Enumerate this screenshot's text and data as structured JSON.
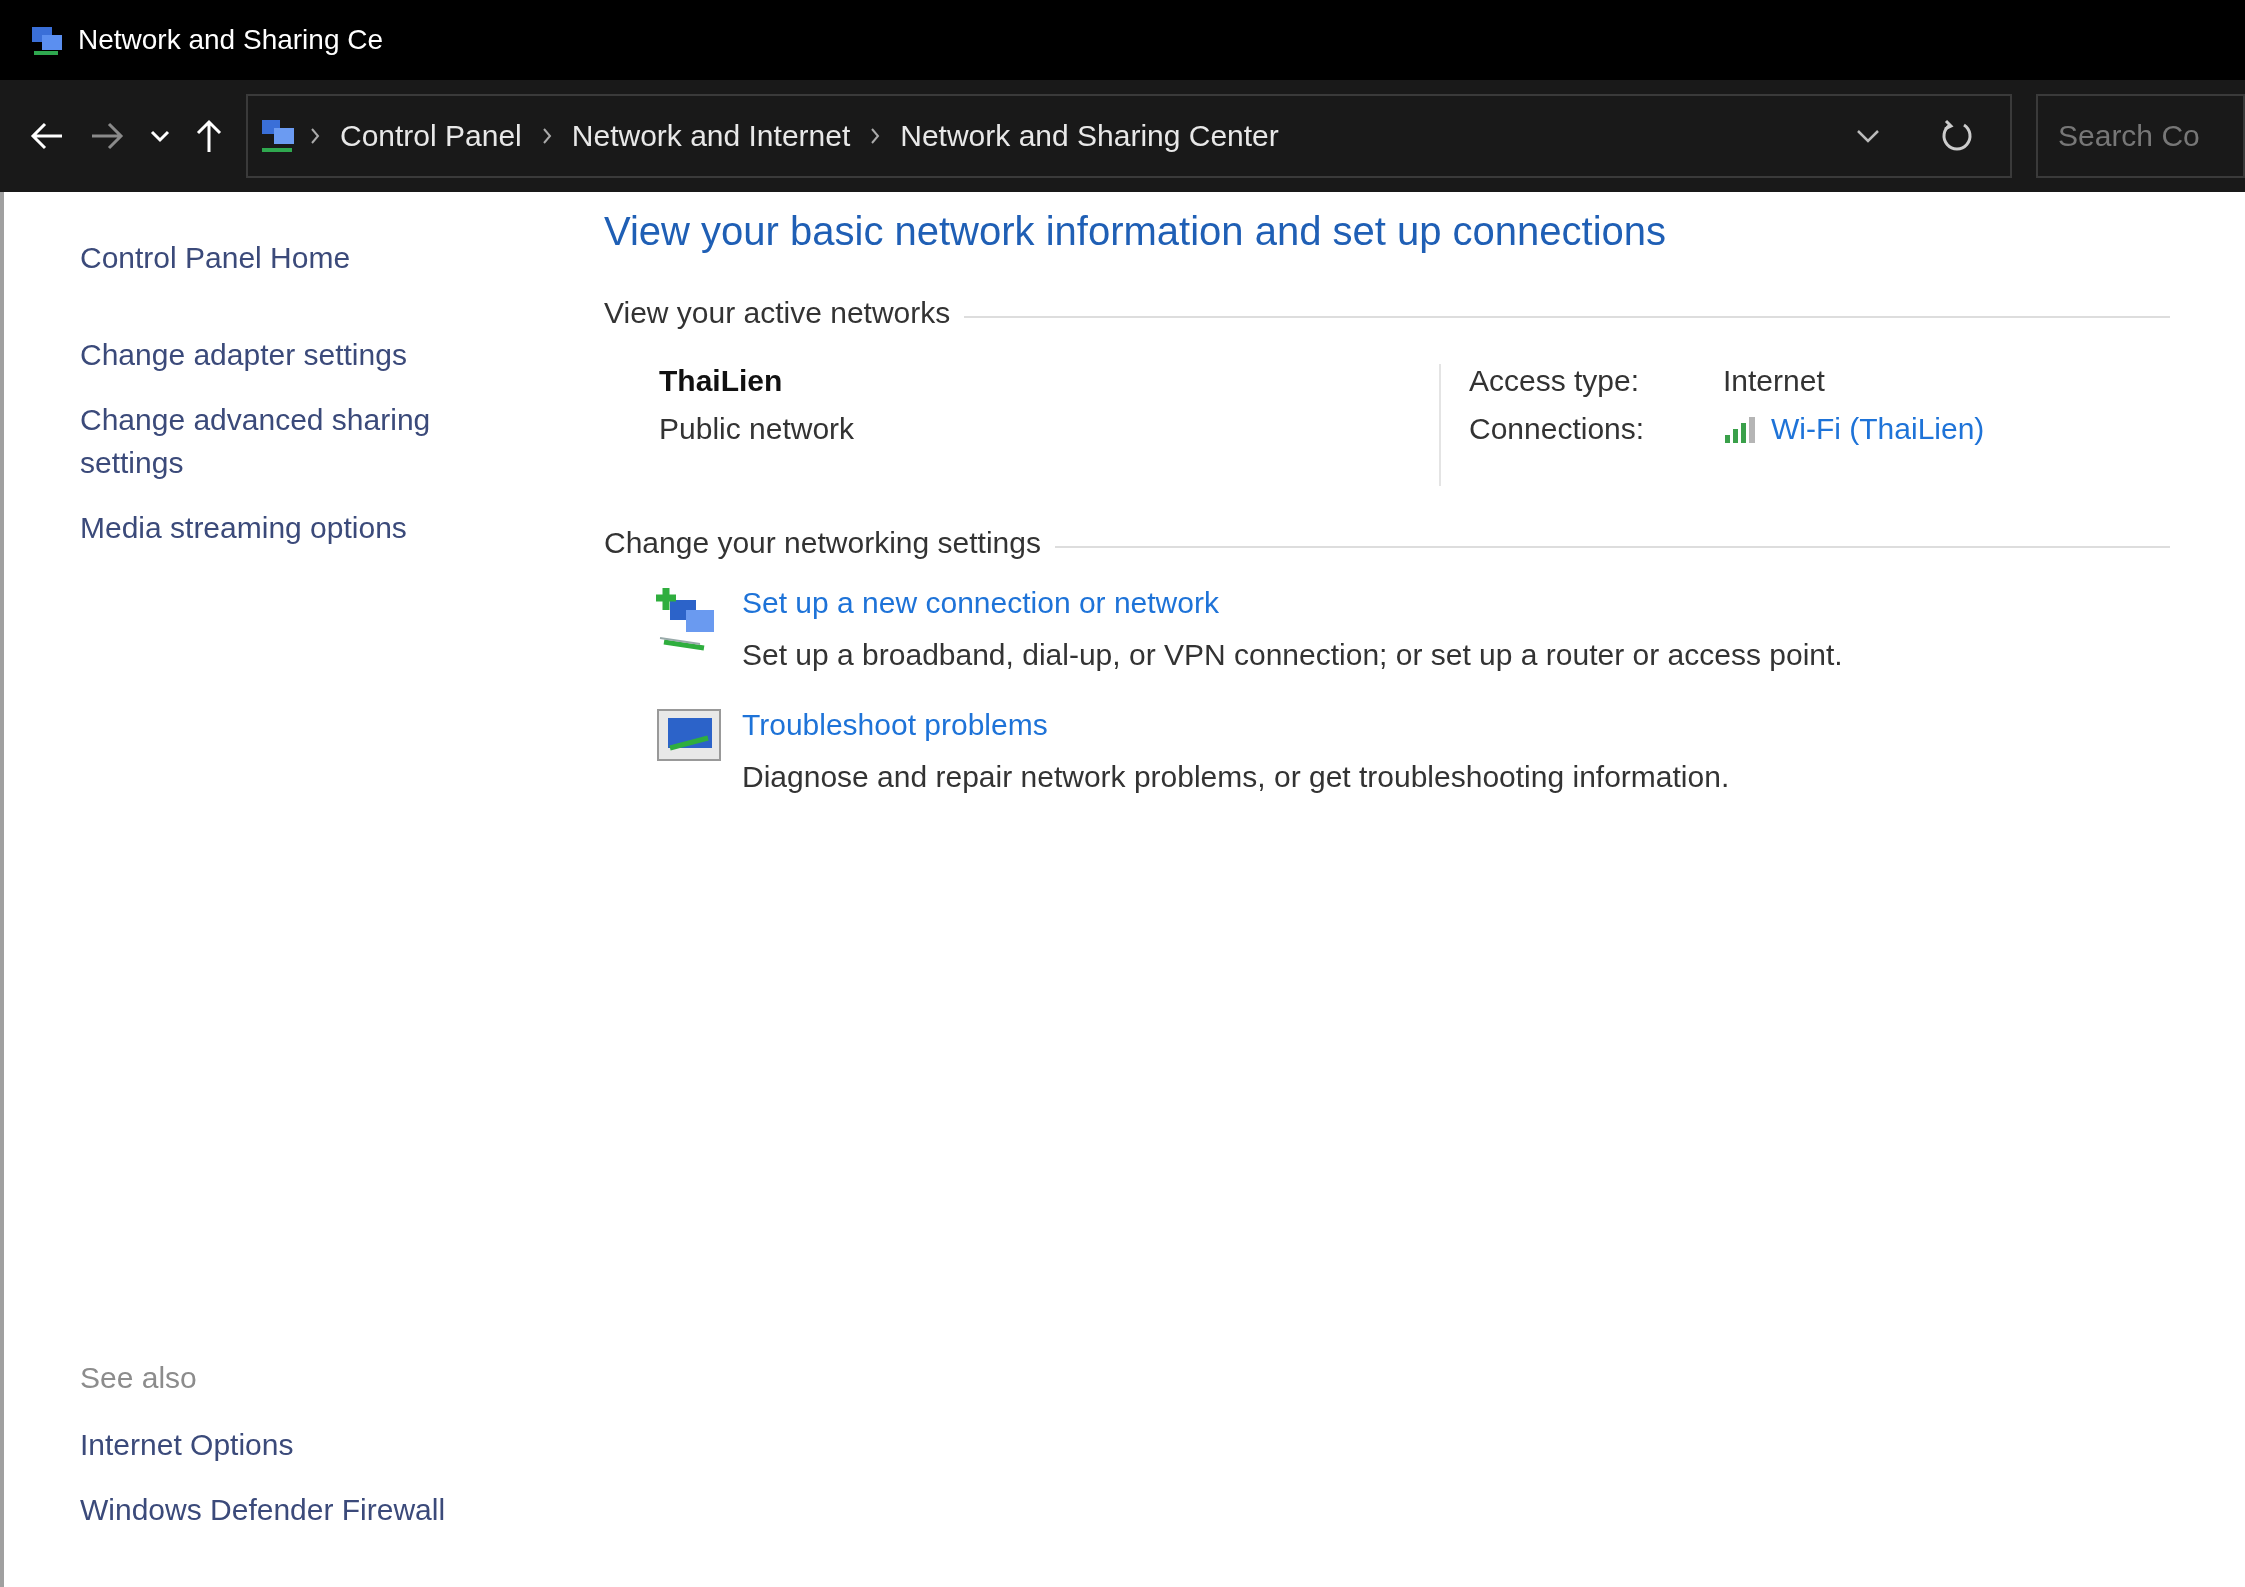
{
  "window": {
    "title": "Network and Sharing Ce"
  },
  "address_bar": {
    "breadcrumbs": [
      "Control Panel",
      "Network and Internet",
      "Network and Sharing Center"
    ]
  },
  "search": {
    "placeholder": "Search Co"
  },
  "sidebar": {
    "items": [
      "Control Panel Home",
      "Change adapter settings",
      "Change advanced sharing settings",
      "Media streaming options"
    ],
    "see_also": {
      "title": "See also",
      "items": [
        "Internet Options",
        "Windows Defender Firewall"
      ]
    }
  },
  "main": {
    "heading": "View your basic network information and set up connections",
    "active_networks": {
      "title": "View your active networks",
      "network": {
        "name": "ThaiLien",
        "category": "Public network"
      },
      "access_type": {
        "label": "Access type:",
        "value": "Internet"
      },
      "connections": {
        "label": "Connections:",
        "value": "Wi-Fi (ThaiLien)"
      }
    },
    "settings": {
      "title": "Change your networking settings",
      "tasks": [
        {
          "kind": "setup",
          "link": "Set up a new connection or network",
          "description": "Set up a broadband, dial-up, or VPN connection; or set up a router or access point."
        },
        {
          "kind": "troubleshoot",
          "link": "Troubleshoot problems",
          "description": "Diagnose and repair network problems, or get troubleshooting information."
        }
      ]
    }
  }
}
